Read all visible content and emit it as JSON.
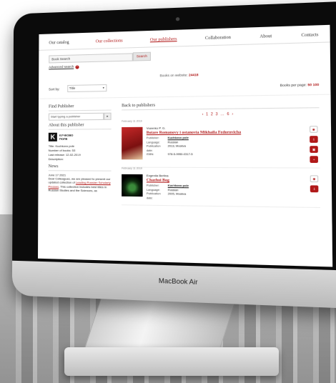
{
  "device": {
    "label": "MacBook Air"
  },
  "nav": {
    "items": [
      "Our catalog",
      "Our collections",
      "Our publishers",
      "Collaboration",
      "About",
      "Contacts"
    ]
  },
  "search": {
    "value": "Book Search",
    "button": "Search",
    "advanced": "Advanced search"
  },
  "stats": {
    "books_label": "Books on website:",
    "books_count": "24418"
  },
  "sort": {
    "label": "Sort by:",
    "value": "Title",
    "perpage_label": "Books per page:",
    "perpage_values": "50 100"
  },
  "sidebar": {
    "find_title": "Find Publisher",
    "find_placeholder": "Start typing a publisher",
    "find_button": "▸",
    "about_title": "About this publisher",
    "logo_text_1": "КУЧКОВО",
    "logo_text_2": "ПОЛЕ",
    "meta": [
      "Title: Kuchkovo pole",
      "Number of books: 53",
      "Last release: 12-02-2019",
      "Description:"
    ],
    "news_title": "News",
    "news_date": "June 17 2021",
    "news_text_1": "Dear Colleagues, we are pleased to present our updated collection of",
    "news_link": "Leading Russian Scholarly Presses",
    "news_text_2": ". This collection includes best titles in Russian Studies and the Sciences, as"
  },
  "main": {
    "back_link": "Back to publishers",
    "pager": "‹ 1 2 3 … 6 ›",
    "books": [
      {
        "date": "February 11 2019",
        "author": "Vozenko P. G.",
        "title": "Boiare Romanovy i ostanovia Mikhaila Fedorovicha",
        "rows": [
          {
            "k": "Publisher:",
            "v": "Kuchkovo pole"
          },
          {
            "k": "Language:",
            "v": "Russian"
          },
          {
            "k": "Publication date:",
            "v": "2013, Moskva"
          },
          {
            "k": "ISBN:",
            "v": "978-5-9950-0317-5"
          }
        ]
      },
      {
        "date": "February 11 2019",
        "author": "Evgeniia Berlina",
        "title": "Chazhoi Bog",
        "rows": [
          {
            "k": "Publisher:",
            "v": "Kuchkovo pole"
          },
          {
            "k": "Language:",
            "v": "Russian"
          },
          {
            "k": "Publication date:",
            "v": "2005, Moskva"
          }
        ]
      }
    ]
  },
  "colors": {
    "accent": "#b01818"
  },
  "icons": {
    "view": "eye-icon",
    "download": "download-icon",
    "cart": "cart-icon",
    "add": "plus-icon"
  }
}
